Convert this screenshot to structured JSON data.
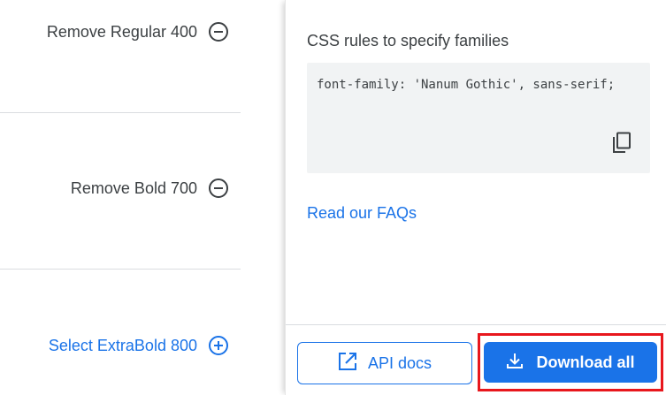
{
  "styles_panel": {
    "rows": [
      {
        "label": "Remove Regular 400",
        "action": "remove",
        "icon": "minus-circle-icon"
      },
      {
        "label": "Remove Bold 700",
        "action": "remove",
        "icon": "minus-circle-icon"
      },
      {
        "label": "Select ExtraBold 800",
        "action": "select",
        "icon": "plus-circle-icon"
      }
    ]
  },
  "drawer": {
    "css_heading": "CSS rules to specify families",
    "css_code": "font-family: 'Nanum Gothic', sans-serif;",
    "copy_icon": "copy-icon",
    "faq_link": "Read our FAQs",
    "api_docs_label": "API docs",
    "api_docs_icon": "open-in-new-icon",
    "download_label": "Download all",
    "download_icon": "download-icon"
  },
  "colors": {
    "accent": "#1a73e8",
    "text": "#3c4043",
    "code_bg": "#f1f3f4",
    "highlight_border": "#e8171d"
  }
}
